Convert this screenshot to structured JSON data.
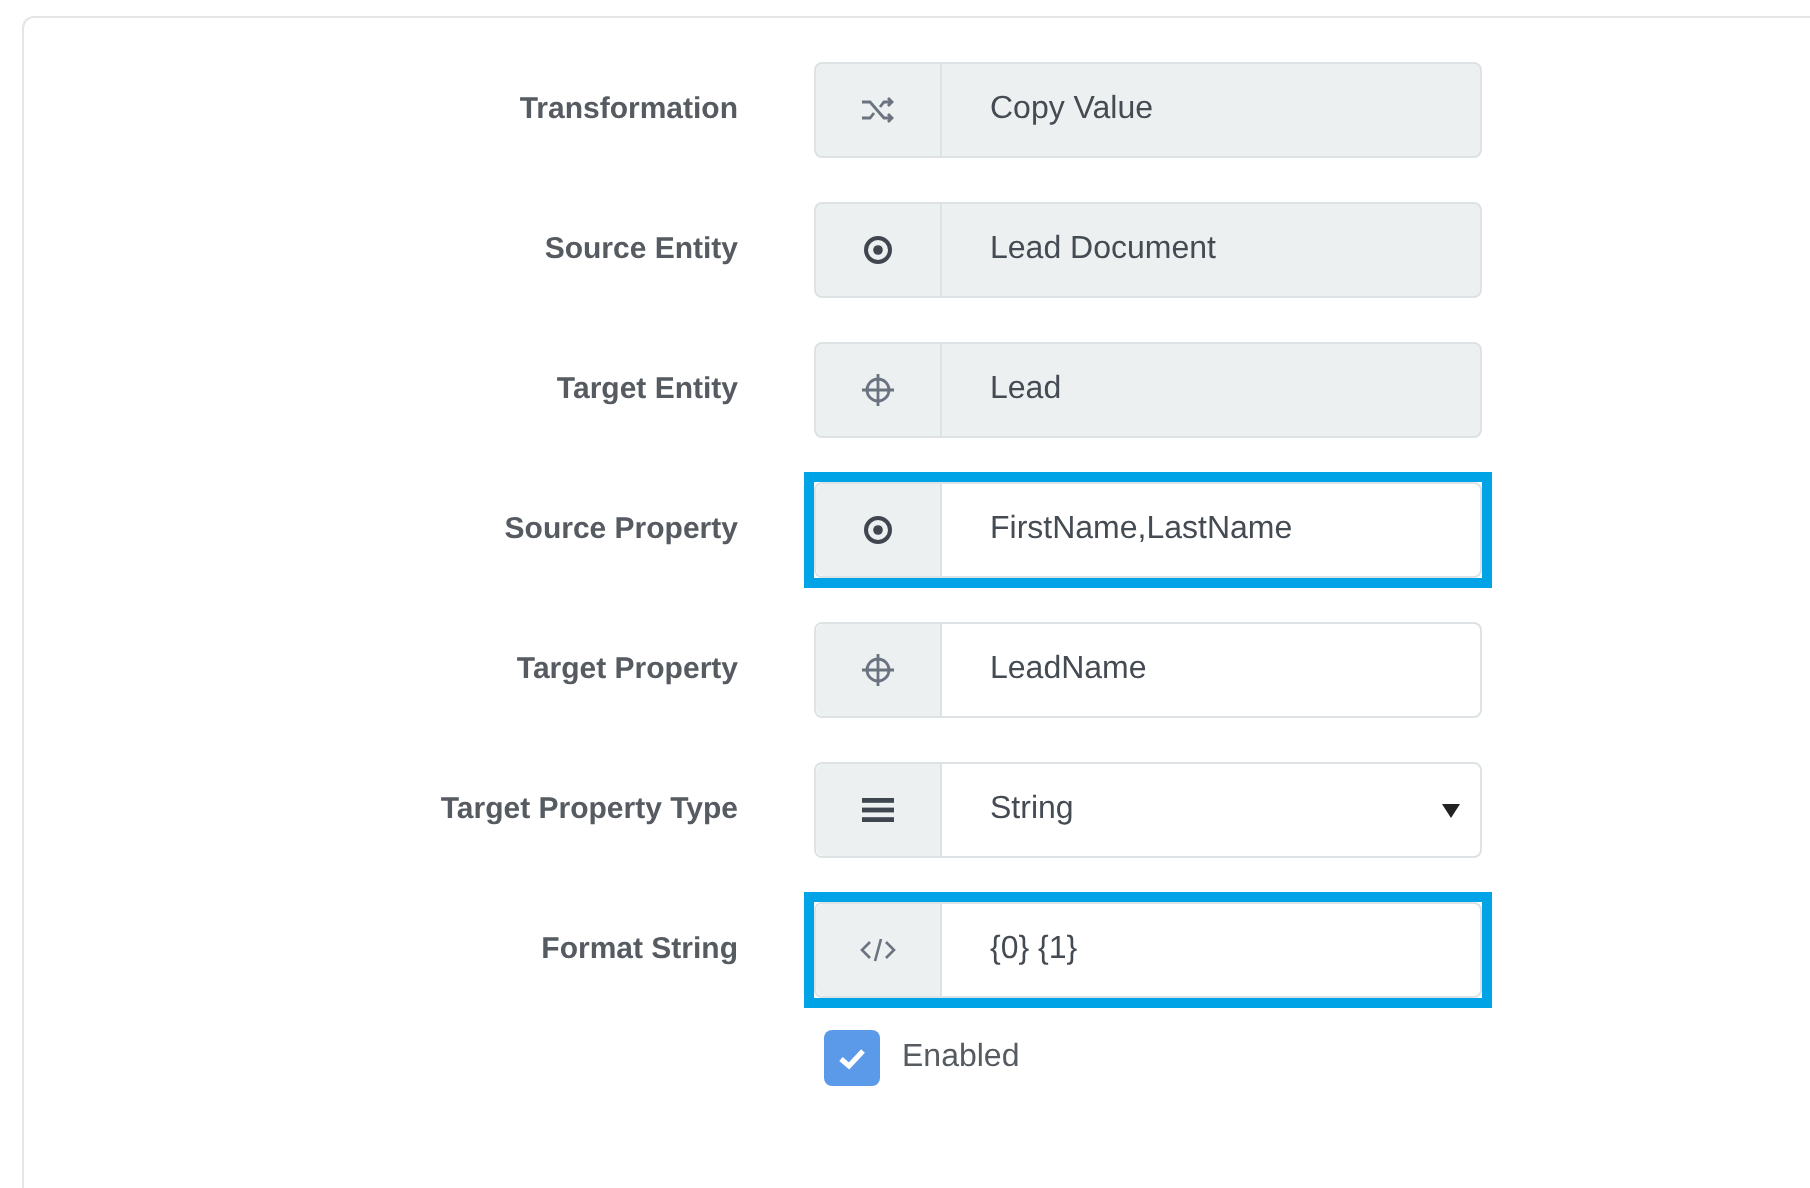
{
  "fields": [
    {
      "label": "Transformation",
      "kind": "shuffle",
      "value": "Copy Value",
      "readonly": true,
      "highlighted": false,
      "dropdown": false
    },
    {
      "label": "Source Entity",
      "kind": "source",
      "value": "Lead Document",
      "readonly": true,
      "highlighted": false,
      "dropdown": false
    },
    {
      "label": "Target Entity",
      "kind": "target",
      "value": "Lead",
      "readonly": true,
      "highlighted": false,
      "dropdown": false
    },
    {
      "label": "Source Property",
      "kind": "source",
      "value": "FirstName,LastName",
      "readonly": false,
      "highlighted": true,
      "dropdown": false
    },
    {
      "label": "Target Property",
      "kind": "target",
      "value": "LeadName",
      "readonly": false,
      "highlighted": false,
      "dropdown": false
    },
    {
      "label": "Target Property Type",
      "kind": "list",
      "value": "String",
      "readonly": false,
      "highlighted": false,
      "dropdown": true
    },
    {
      "label": "Format String",
      "kind": "code",
      "value": "{0} {1}",
      "readonly": false,
      "highlighted": true,
      "dropdown": false
    }
  ],
  "enabled": {
    "label": "Enabled",
    "checked": true
  }
}
